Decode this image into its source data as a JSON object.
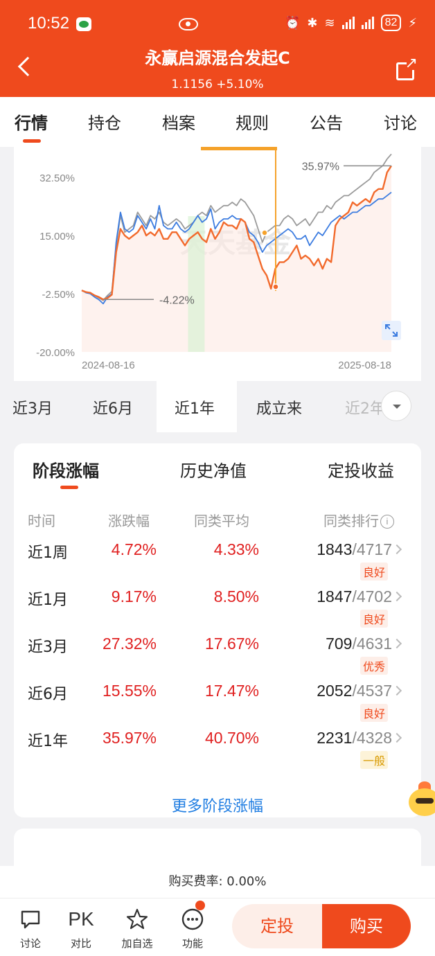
{
  "status_bar": {
    "time": "10:52",
    "battery": "82"
  },
  "header": {
    "title": "永赢启源混合发起C",
    "subtitle": "1.1156 +5.10%"
  },
  "top_tabs": [
    "行情",
    "持仓",
    "档案",
    "规则",
    "公告",
    "讨论"
  ],
  "chart_data": {
    "type": "line",
    "yticks": [
      "32.50%",
      "15.00%",
      "-2.50%",
      "-20.00%"
    ],
    "ylim": [
      -20,
      32.5
    ],
    "x_start_label": "2024-08-16",
    "x_end_label": "2025-08-18",
    "annotations": {
      "min_label": "-4.22%",
      "max_label": "35.97%"
    },
    "watermark": "天天基金",
    "series": [
      {
        "color": "#f26a2c",
        "values": [
          -1.5,
          -2.0,
          -2.2,
          -3.0,
          -3.5,
          -4.22,
          -3.8,
          -2.8,
          10,
          17,
          15,
          14,
          15,
          16,
          18,
          15,
          16,
          15,
          17,
          14,
          14,
          16,
          16,
          14,
          12,
          14,
          15,
          16,
          14,
          13,
          17,
          14,
          16,
          19,
          18,
          18,
          17,
          20,
          19,
          14,
          13,
          9,
          5,
          3,
          -1,
          5,
          7,
          7,
          8,
          10,
          12,
          8,
          9,
          8,
          6,
          8,
          5,
          8,
          7,
          18,
          20,
          21,
          22,
          25,
          24,
          25,
          26,
          25,
          28,
          29,
          29,
          34,
          35.97
        ]
      },
      {
        "color": "#3c7ce0",
        "values": [
          -1.5,
          -2.2,
          -2.5,
          -3.5,
          -4.3,
          -5.5,
          -3.5,
          -2.5,
          13,
          22,
          17,
          16,
          17,
          21,
          19,
          17,
          20,
          17,
          24,
          18,
          17,
          17,
          19,
          17,
          16,
          17,
          19,
          21,
          19,
          20,
          23,
          17,
          19,
          20,
          20,
          21,
          20,
          20,
          19,
          16,
          15,
          13,
          10,
          12,
          13,
          14,
          15,
          16,
          17,
          16,
          14,
          14,
          15,
          12,
          14,
          16,
          15,
          17,
          19,
          20,
          21,
          20,
          21,
          22,
          22,
          23,
          24,
          24,
          25,
          26,
          26,
          27,
          28
        ]
      },
      {
        "color": "#9a9a9a",
        "values": [
          -1.5,
          -2.0,
          -2.2,
          -3.0,
          -3.8,
          -4.5,
          -3.0,
          -1.8,
          12,
          21,
          16,
          17,
          18,
          22,
          20,
          18,
          21,
          20,
          22,
          19,
          18,
          19,
          20,
          19,
          17,
          18,
          19,
          21,
          22,
          21,
          24,
          22,
          23,
          24,
          24,
          25,
          24,
          26,
          25,
          23,
          21,
          17,
          13,
          16,
          17,
          18,
          18,
          20,
          21,
          20,
          18,
          19,
          20,
          18,
          20,
          22,
          22,
          24,
          23,
          25,
          26,
          27,
          27,
          28,
          29,
          30,
          31,
          32,
          34,
          35,
          36,
          38,
          39.5
        ]
      }
    ]
  },
  "period_tabs": [
    "近3月",
    "近6月",
    "近1年",
    "成立来",
    "近2年"
  ],
  "perf_tabs": [
    "阶段涨幅",
    "历史净值",
    "定投收益"
  ],
  "perf_headers": {
    "period": "时间",
    "change": "涨跌幅",
    "avg": "同类平均",
    "rank": "同类排行"
  },
  "perf_rows": [
    {
      "period": "近1周",
      "change": "4.72%",
      "avg": "4.33%",
      "rank": "1843",
      "total": "/4717",
      "badge": "良好",
      "badge_type": "good"
    },
    {
      "period": "近1月",
      "change": "9.17%",
      "avg": "8.50%",
      "rank": "1847",
      "total": "/4702",
      "badge": "良好",
      "badge_type": "good"
    },
    {
      "period": "近3月",
      "change": "27.32%",
      "avg": "17.67%",
      "rank": "709",
      "total": "/4631",
      "badge": "优秀",
      "badge_type": "excellent"
    },
    {
      "period": "近6月",
      "change": "15.55%",
      "avg": "17.47%",
      "rank": "2052",
      "total": "/4537",
      "badge": "良好",
      "badge_type": "good"
    },
    {
      "period": "近1年",
      "change": "35.97%",
      "avg": "40.70%",
      "rank": "2231",
      "total": "/4328",
      "badge": "一般",
      "badge_type": "normal"
    }
  ],
  "more_link": "更多阶段涨幅",
  "fee_text": "购买费率: 0.00%",
  "bottom_nav": [
    {
      "label": "讨论",
      "icon": "chat-icon"
    },
    {
      "label": "对比",
      "icon_text": "PK"
    },
    {
      "label": "加自选",
      "icon": "star-icon"
    },
    {
      "label": "功能",
      "icon": "more-icon"
    }
  ],
  "buttons": {
    "sip": "定投",
    "buy": "购买"
  }
}
